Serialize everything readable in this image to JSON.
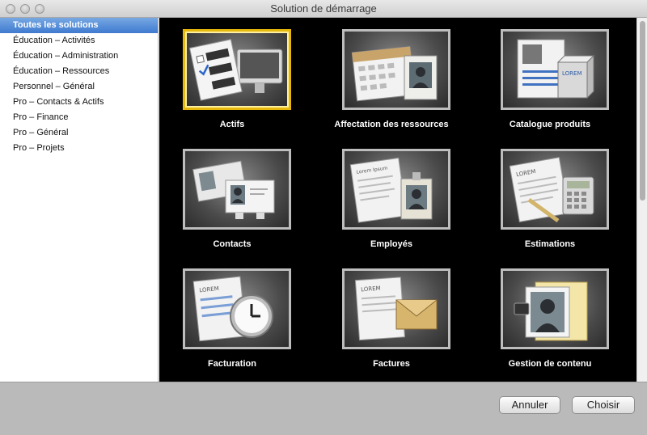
{
  "window": {
    "title": "Solution de démarrage"
  },
  "sidebar": {
    "items": [
      {
        "label": "Toutes les solutions",
        "selected": true
      },
      {
        "label": "Éducation – Activités"
      },
      {
        "label": "Éducation – Administration"
      },
      {
        "label": "Éducation – Ressources"
      },
      {
        "label": "Personnel – Général"
      },
      {
        "label": "Pro – Contacts & Actifs"
      },
      {
        "label": "Pro – Finance"
      },
      {
        "label": "Pro – Général"
      },
      {
        "label": "Pro – Projets"
      }
    ]
  },
  "solutions": [
    {
      "label": "Actifs",
      "icon": "assets-icon",
      "selected": true
    },
    {
      "label": "Affectation des ressources",
      "icon": "resource-allocation-icon"
    },
    {
      "label": "Catalogue produits",
      "icon": "product-catalog-icon",
      "badge": "LOREM"
    },
    {
      "label": "Contacts",
      "icon": "contacts-icon"
    },
    {
      "label": "Employés",
      "icon": "employees-icon",
      "badge": "Lorem Ipsum"
    },
    {
      "label": "Estimations",
      "icon": "estimates-icon",
      "badge": "LOREM"
    },
    {
      "label": "Facturation",
      "icon": "billing-icon",
      "badge": "LOREM"
    },
    {
      "label": "Factures",
      "icon": "invoices-icon",
      "badge": "LOREM"
    },
    {
      "label": "Gestion de contenu",
      "icon": "content-management-icon"
    }
  ],
  "colors": {
    "selection": "#3f7ad0",
    "tile_highlight": "#e6b80c",
    "grid_background": "#000000"
  },
  "buttons": {
    "cancel": "Annuler",
    "choose": "Choisir"
  }
}
